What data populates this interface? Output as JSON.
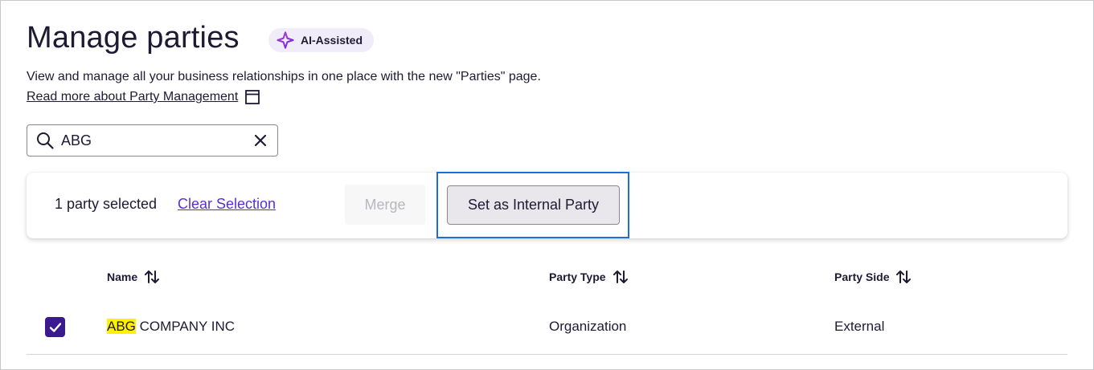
{
  "header": {
    "title": "Manage parties",
    "badge": "AI-Assisted",
    "subtitle": "View and manage all your business relationships in one place with the new \"Parties\" page.",
    "read_more": "Read more about Party Management"
  },
  "search": {
    "value": "ABG",
    "placeholder": ""
  },
  "selection_bar": {
    "count_text": "1 party selected",
    "clear_label": "Clear Selection",
    "merge_label": "Merge",
    "internal_label": "Set as Internal Party"
  },
  "table": {
    "columns": [
      "Name",
      "Party Type",
      "Party Side"
    ],
    "rows": [
      {
        "name_highlight": "ABG",
        "name_rest": " COMPANY INC",
        "type": "Organization",
        "side": "External",
        "selected": true
      }
    ]
  },
  "colors": {
    "accent": "#5a2fd1",
    "checkbox": "#3b1a8f",
    "highlight": "#fff200",
    "focus_box": "#1e6fd9"
  }
}
